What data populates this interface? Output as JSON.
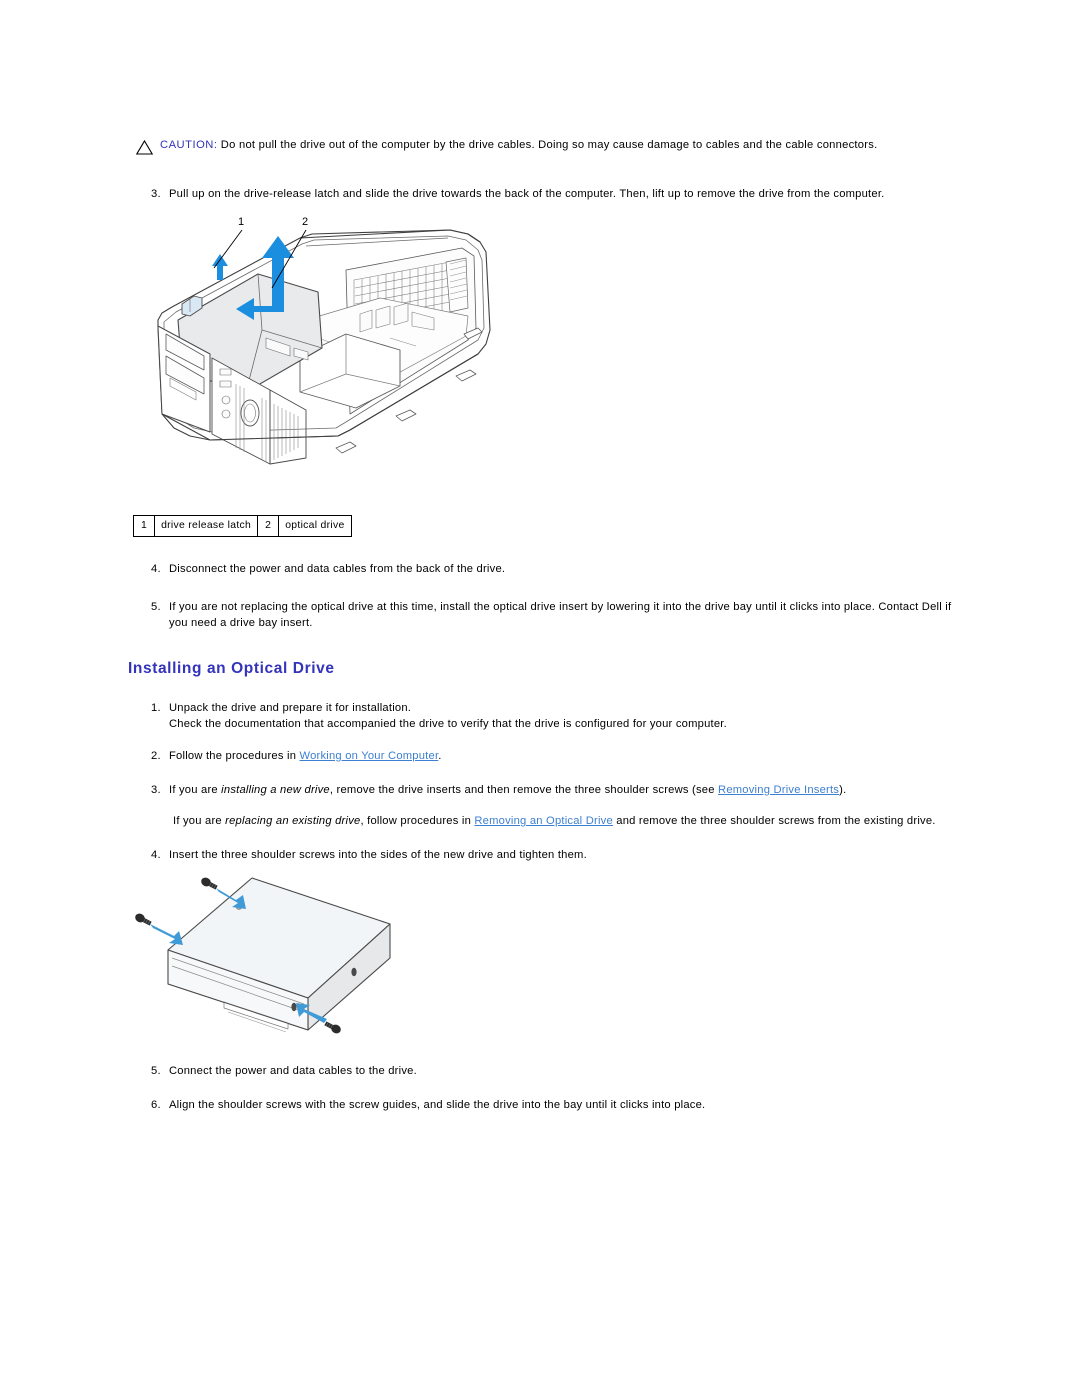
{
  "document": {
    "caution": {
      "icon": "warning-triangle-icon",
      "label": "CAUTION:",
      "text": " Do not pull the drive out of the computer by the drive cables. Doing so may cause damage to cables and the cable connectors."
    },
    "removal_steps": [
      {
        "number": "3.",
        "text": "Pull up on the drive-release latch and slide the drive towards the back of the computer. Then, lift up to remove the drive from the computer."
      },
      {
        "number": "4.",
        "text": "Disconnect the power and data cables from the back of the drive."
      },
      {
        "number": "5.",
        "text": "If you are not replacing the optical drive at this time, install the optical drive insert by lowering it into the drive bay until it clicks into place. Contact Dell if you need a drive bay insert."
      }
    ],
    "figure_chassis": {
      "name": "computer-chassis-optical-drive-removal",
      "callouts": [
        "1",
        "2"
      ],
      "arrow_color": "#1c8ee0",
      "legend": [
        {
          "number": "1",
          "label": "drive release latch"
        },
        {
          "number": "2",
          "label": "optical drive"
        }
      ]
    },
    "section": {
      "heading": "Installing an Optical Drive"
    },
    "install_steps": [
      {
        "number": "1.",
        "line1": "Unpack the drive and prepare it for installation.",
        "line2": "Check the documentation that accompanied the drive to verify that the drive is configured for your computer."
      },
      {
        "number": "2.",
        "pre": "Follow the procedures in ",
        "link": "Working on Your Computer",
        "post": "."
      },
      {
        "number": "3.",
        "pre": "If you are ",
        "italic": "installing a new drive",
        "mid": ", remove the drive inserts and then remove the three shoulder screws (see ",
        "link": "Removing Drive Inserts",
        "post": ").",
        "alt_pre": "If you are ",
        "alt_italic": "replacing an existing drive",
        "alt_mid": ", follow procedures in ",
        "alt_link": "Removing an Optical Drive",
        "alt_post": " and remove the three shoulder screws from the existing drive."
      },
      {
        "number": "4.",
        "text": "Insert the three shoulder screws into the sides of the new drive and tighten them."
      },
      {
        "number": "5.",
        "text": "Connect the power and data cables to the drive."
      },
      {
        "number": "6.",
        "text": "Align the shoulder screws with the screw guides, and slide the drive into the bay until it clicks into place."
      }
    ],
    "figure_drive": {
      "name": "optical-drive-with-shoulder-screws",
      "arrow_color": "#3f9ad8",
      "screw_count": "3"
    }
  }
}
